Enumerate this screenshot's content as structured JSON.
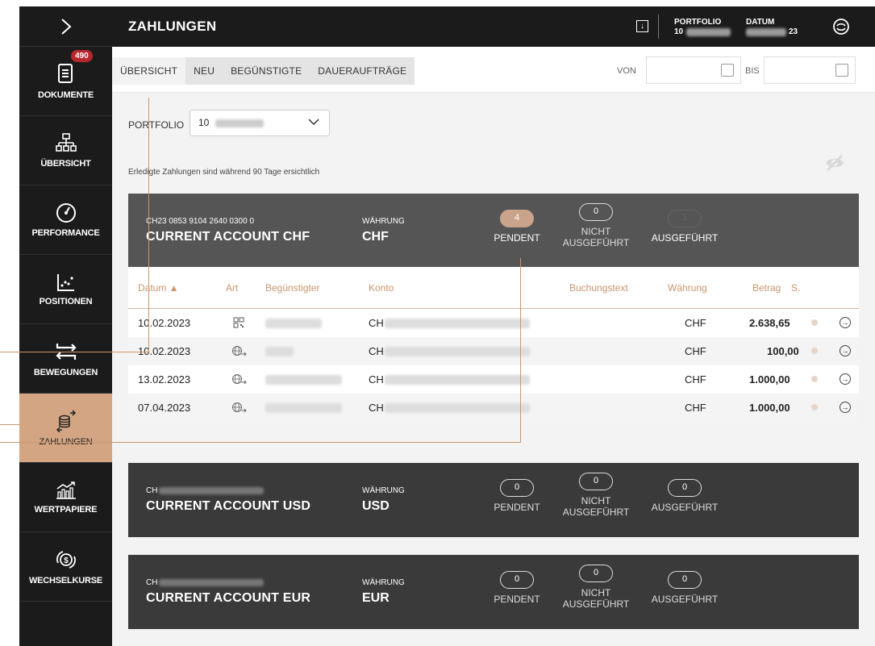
{
  "sidebar": {
    "toggle_icon": "chevron-right-icon",
    "items": [
      {
        "label": "DOKUMENTE",
        "icon": "document-icon",
        "badge": "490",
        "active": false
      },
      {
        "label": "ÜBERSICHT",
        "icon": "hierarchy-icon",
        "active": false
      },
      {
        "label": "PERFORMANCE",
        "icon": "gauge-icon",
        "active": false
      },
      {
        "label": "POSITIONEN",
        "icon": "scatter-chart-icon",
        "active": false
      },
      {
        "label": "BEWEGUNGEN",
        "icon": "swap-arrows-icon",
        "active": false
      },
      {
        "label": "ZAHLUNGEN",
        "icon": "coins-transfer-icon",
        "active": true
      },
      {
        "label": "WERTPAPIERE",
        "icon": "stock-chart-icon",
        "active": false
      },
      {
        "label": "WECHSELKURSE",
        "icon": "currency-exchange-icon",
        "active": false
      }
    ]
  },
  "topbar": {
    "title": "ZAHLUNGEN",
    "portfolio_label": "PORTFOLIO",
    "portfolio_value": "10",
    "datum_label": "DATUM",
    "datum_value": "23"
  },
  "tabs": [
    "ÜBERSICHT",
    "NEU",
    "BEGÜNSTIGTE",
    "DAUERAUFTRÄGE"
  ],
  "date_filter": {
    "from_label": "VON",
    "to_label": "BIS",
    "from_value": "",
    "to_value": ""
  },
  "portfolio_select": {
    "label": "PORTFOLIO",
    "value": "10"
  },
  "info_text": "Erledigte Zahlungen sind während 90 Tage ersichtlich",
  "accounts": [
    {
      "iban": "CH23 0853 9104 2640 0300 0",
      "name": "CURRENT ACCOUNT CHF",
      "currency_label": "WÄHRUNG",
      "currency": "CHF",
      "pendent_count": "4",
      "pendent_label": "PENDENT",
      "nicht_count": "0",
      "nicht_label": "NICHT AUSGEFÜHRT",
      "ausg_count": "1",
      "ausg_label": "AUSGEFÜHRT"
    },
    {
      "iban": "CH",
      "name": "CURRENT ACCOUNT USD",
      "currency_label": "WÄHRUNG",
      "currency": "USD",
      "pendent_count": "0",
      "pendent_label": "PENDENT",
      "nicht_count": "0",
      "nicht_label": "NICHT AUSGEFÜHRT",
      "ausg_count": "0",
      "ausg_label": "AUSGEFÜHRT"
    },
    {
      "iban": "CH",
      "name": "CURRENT ACCOUNT EUR",
      "currency_label": "WÄHRUNG",
      "currency": "EUR",
      "pendent_count": "0",
      "pendent_label": "PENDENT",
      "nicht_count": "0",
      "nicht_label": "NICHT AUSGEFÜHRT",
      "ausg_count": "0",
      "ausg_label": "AUSGEFÜHRT"
    }
  ],
  "table": {
    "headers": [
      "Datum ▲",
      "Art",
      "Begünstigter",
      "Konto",
      "Buchungstext",
      "Währung",
      "Betrag",
      "S."
    ],
    "rows": [
      {
        "date": "10.02.2023",
        "type_icon": "qr-code-icon",
        "konto": "CH",
        "currency": "CHF",
        "amount": "2.638,65"
      },
      {
        "date": "10.02.2023",
        "type_icon": "globe-transfer-icon",
        "konto": "CH",
        "currency": "CHF",
        "amount": "100,00"
      },
      {
        "date": "13.02.2023",
        "type_icon": "globe-transfer-icon",
        "konto": "CH",
        "currency": "CHF",
        "amount": "1.000,00"
      },
      {
        "date": "07.04.2023",
        "type_icon": "globe-transfer-icon",
        "konto": "CH",
        "currency": "CHF",
        "amount": "1.000,00"
      }
    ]
  },
  "colors": {
    "accent": "#c9956f",
    "sidebar_bg": "#1b1b1b",
    "active_nav": "#d3a582",
    "card_bg": "#3a3a3a"
  }
}
